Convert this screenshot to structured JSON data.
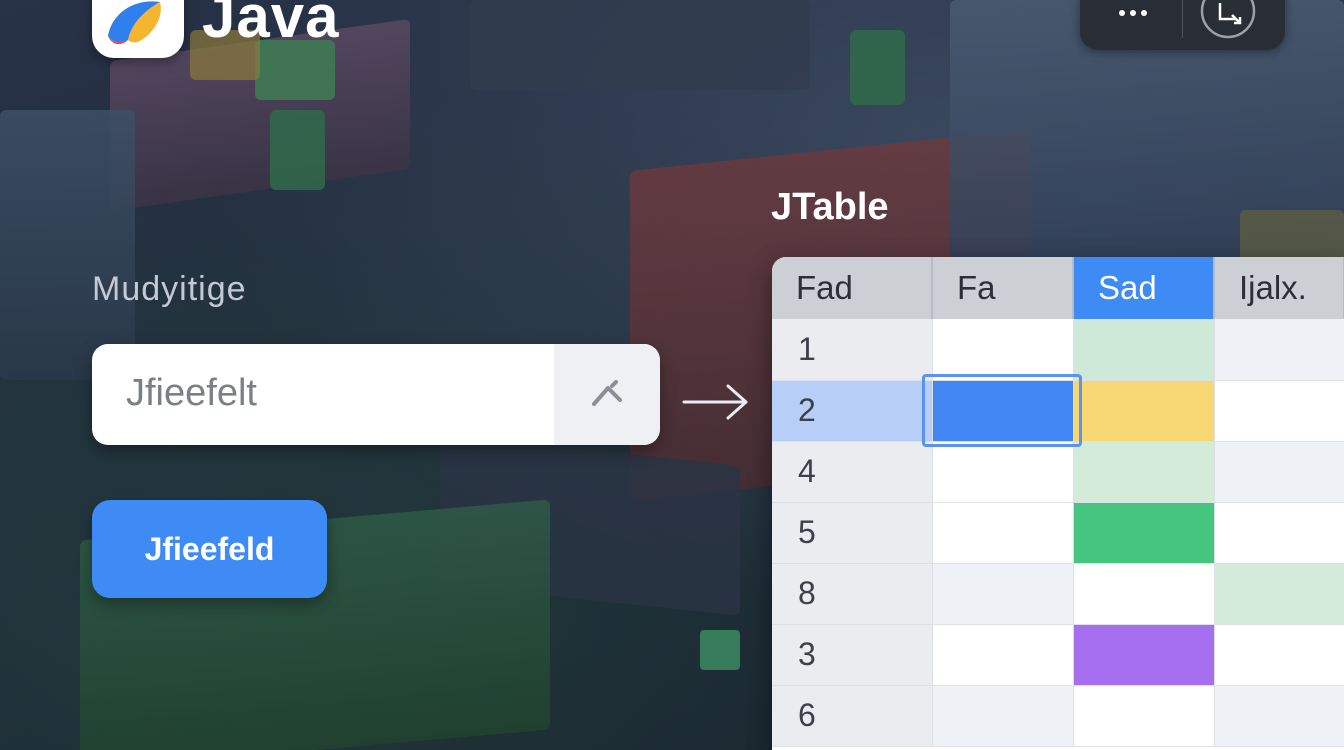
{
  "app": {
    "title": "Java",
    "logo_icon": "java-logo-icon"
  },
  "window_controls": {
    "more_icon": "more-horizontal-icon",
    "restore_icon": "restore-window-icon"
  },
  "form": {
    "label": "Mudyitige",
    "text_field_value": "Jfieefelt",
    "clear_icon": "clear-field-icon",
    "button_label": "Jfieefeld"
  },
  "connector": {
    "icon": "arrow-right-icon"
  },
  "table": {
    "title": "JTable",
    "columns": [
      "Fad",
      "Fa",
      "Sad",
      "Ijalx."
    ],
    "selected_column": 2,
    "selected_row": 1,
    "rows": [
      {
        "num": "1",
        "cells": [
          "#ffffff",
          "#cfe9d9",
          "#eef1f6"
        ]
      },
      {
        "num": "2",
        "cells": [
          "#4286f4",
          "#f7d774",
          "#ffffff"
        ]
      },
      {
        "num": "4",
        "cells": [
          "#ffffff",
          "#d2ecd9",
          "#eef1f6"
        ]
      },
      {
        "num": "5",
        "cells": [
          "#ffffff",
          "#46c57f",
          "#ffffff"
        ]
      },
      {
        "num": "8",
        "cells": [
          "#eef1f6",
          "#ffffff",
          "#d2ecd9"
        ]
      },
      {
        "num": "3",
        "cells": [
          "#ffffff",
          "#a56ff0",
          "#ffffff"
        ]
      },
      {
        "num": "6",
        "cells": [
          "#eef1f6",
          "#ffffff",
          "#eef1f6"
        ]
      }
    ]
  },
  "colors": {
    "accent": "#3f8bf5",
    "header_bg": "#ccd0d5",
    "selected_row_bg": "#b7cff7"
  }
}
